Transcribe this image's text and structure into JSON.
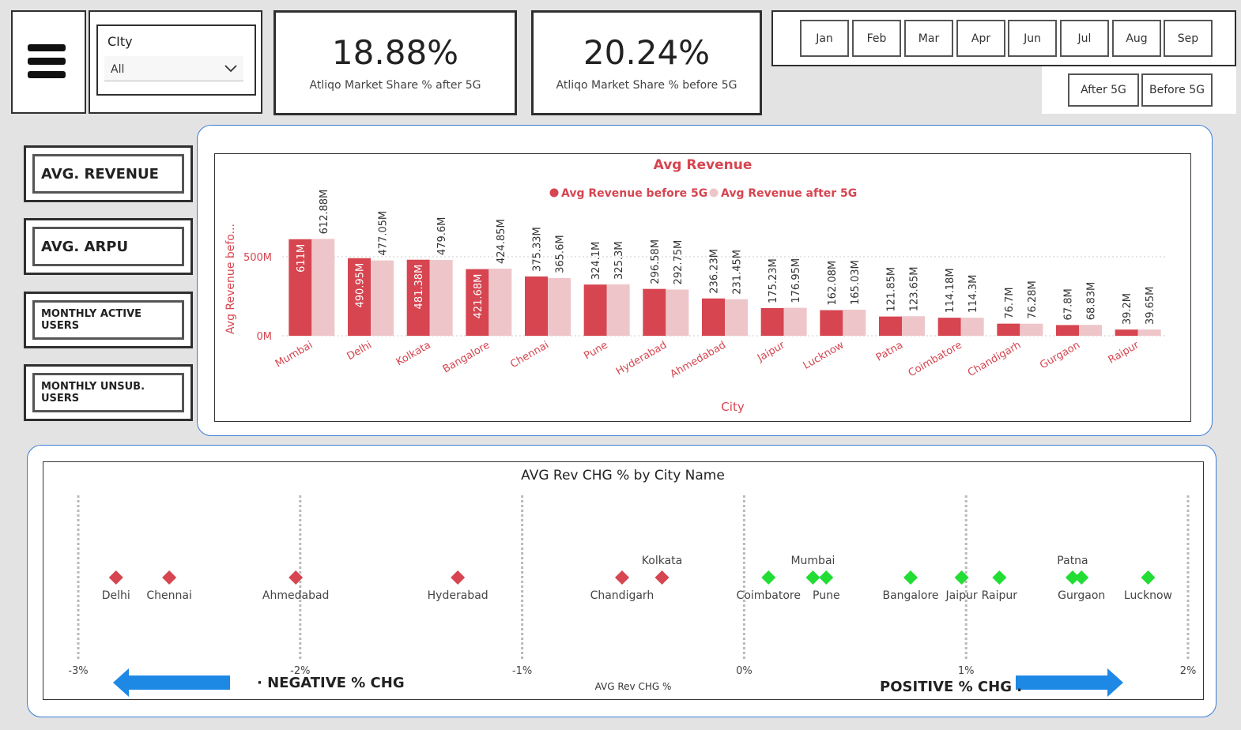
{
  "filters": {
    "city_label": "CIty",
    "city_value": "All"
  },
  "kpis": [
    {
      "value": "18.88%",
      "label": "Atliqo Market Share % after 5G"
    },
    {
      "value": "20.24%",
      "label": "Atliqo Market Share % before 5G"
    }
  ],
  "months": [
    "Jan",
    "Feb",
    "Mar",
    "Apr",
    "Jun",
    "Jul",
    "Aug",
    "Sep"
  ],
  "periods": [
    "After 5G",
    "Before 5G"
  ],
  "nav": [
    "AVG. REVENUE",
    "AVG. ARPU",
    "MONTHLY ACTIVE USERS",
    "MONTHLY UNSUB. USERS"
  ],
  "colors": {
    "before": "#d64550",
    "after": "#eec6ca",
    "negative": "#d64550",
    "positive": "#22dd33",
    "arrow": "#1e88e5",
    "panel_border": "#3a7dd6"
  },
  "chart_data": [
    {
      "type": "bar",
      "title": "Avg Revenue",
      "xlabel": "City",
      "ylabel": "Avg Revenue befo...",
      "yticks": [
        "0M",
        "500M"
      ],
      "ylim": [
        0,
        700
      ],
      "legend_position": "top-center",
      "categories": [
        "Mumbai",
        "Delhi",
        "Kolkata",
        "Bangalore",
        "Chennai",
        "Pune",
        "Hyderabad",
        "Ahmedabad",
        "Jaipur",
        "Lucknow",
        "Patna",
        "Coimbatore",
        "Chandigarh",
        "Gurgaon",
        "Raipur"
      ],
      "series": [
        {
          "name": "Avg Revenue before 5G",
          "values": [
            611,
            490.95,
            481.38,
            421.68,
            375.33,
            324.1,
            296.58,
            236.23,
            175.23,
            162.08,
            121.85,
            114.18,
            76.7,
            67.8,
            39.2
          ],
          "labels": [
            "611M",
            "490.95M",
            "481.38M",
            "421.68M",
            "375.33M",
            "324.1M",
            "296.58M",
            "236.23M",
            "175.23M",
            "162.08M",
            "121.85M",
            "114.18M",
            "76.7M",
            "67.8M",
            "39.2M"
          ]
        },
        {
          "name": "Avg Revenue after 5G",
          "values": [
            612.88,
            477.05,
            479.6,
            424.85,
            365.6,
            325.3,
            292.75,
            231.45,
            176.95,
            165.03,
            123.65,
            114.3,
            76.28,
            68.83,
            39.65
          ],
          "labels": [
            "612.88M",
            "477.05M",
            "479.6M",
            "424.85M",
            "365.6M",
            "325.3M",
            "292.75M",
            "231.45M",
            "176.95M",
            "165.03M",
            "123.65M",
            "114.3M",
            "76.28M",
            "68.83M",
            "39.65M"
          ]
        }
      ]
    },
    {
      "type": "scatter",
      "title": "AVG Rev CHG % by City Name",
      "xlabel": "AVG Rev CHG %",
      "xlim": [
        -3,
        2
      ],
      "xticks": [
        "-3%",
        "-2%",
        "-1%",
        "0%",
        "1%",
        "2%"
      ],
      "points": [
        {
          "city": "Delhi",
          "x": -2.83,
          "label_pos": "below"
        },
        {
          "city": "Chennai",
          "x": -2.59,
          "label_pos": "below"
        },
        {
          "city": "Ahmedabad",
          "x": -2.02,
          "label_pos": "below"
        },
        {
          "city": "Hyderabad",
          "x": -1.29,
          "label_pos": "below"
        },
        {
          "city": "Chandigarh",
          "x": -0.55,
          "label_pos": "below"
        },
        {
          "city": "Kolkata",
          "x": -0.37,
          "label_pos": "above"
        },
        {
          "city": "Coimbatore",
          "x": 0.11,
          "label_pos": "below"
        },
        {
          "city": "Mumbai",
          "x": 0.31,
          "label_pos": "above"
        },
        {
          "city": "Pune",
          "x": 0.37,
          "label_pos": "below"
        },
        {
          "city": "Bangalore",
          "x": 0.75,
          "label_pos": "below"
        },
        {
          "city": "Jaipur",
          "x": 0.98,
          "label_pos": "below"
        },
        {
          "city": "Raipur",
          "x": 1.15,
          "label_pos": "below"
        },
        {
          "city": "Patna",
          "x": 1.48,
          "label_pos": "above"
        },
        {
          "city": "Gurgaon",
          "x": 1.52,
          "label_pos": "below"
        },
        {
          "city": "Lucknow",
          "x": 1.82,
          "label_pos": "below"
        }
      ],
      "annotations": {
        "negative": "· NEGATIVE % CHG",
        "positive": "POSITIVE % CHG ."
      }
    }
  ]
}
